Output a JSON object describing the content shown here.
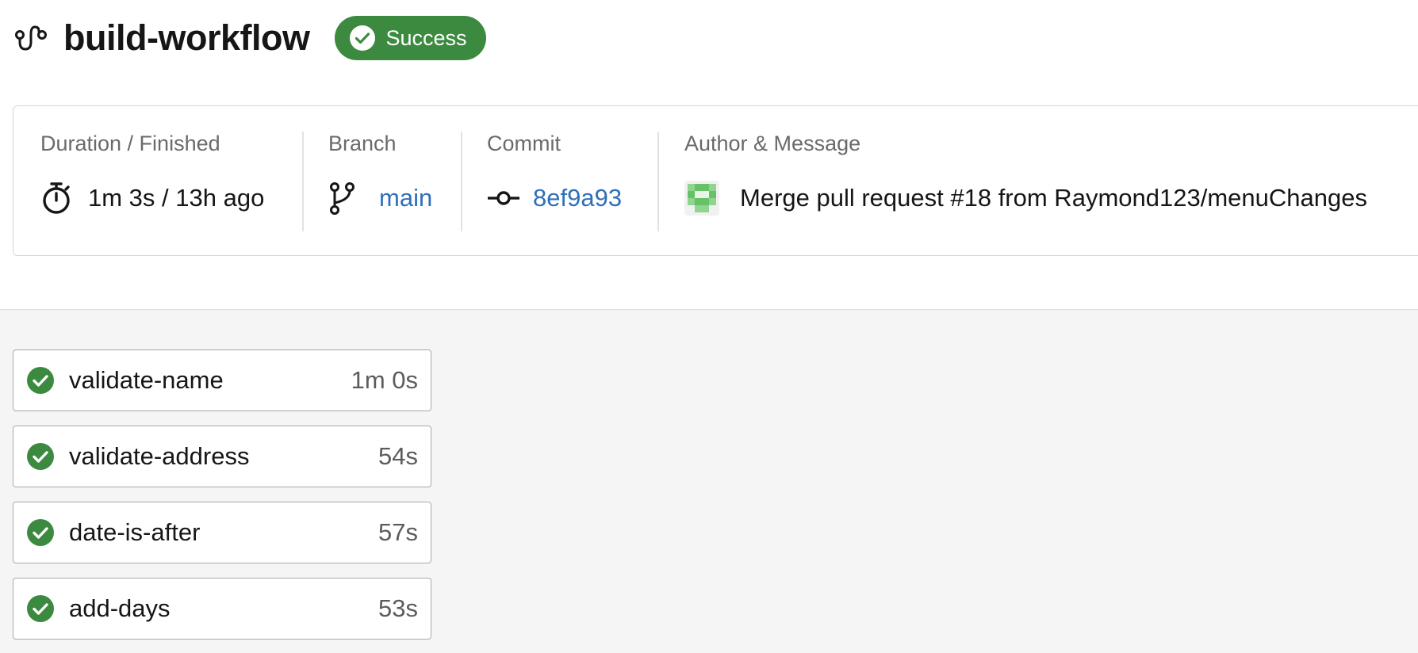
{
  "workflow": {
    "title": "build-workflow",
    "status": "Success",
    "icon": "workflow-icon",
    "status_color": "#3c8a3f"
  },
  "summary": {
    "duration": {
      "label": "Duration / Finished",
      "value": "1m 3s / 13h ago",
      "icon": "timer-icon"
    },
    "branch": {
      "label": "Branch",
      "value": "main",
      "icon": "branch-icon"
    },
    "commit": {
      "label": "Commit",
      "value": "8ef9a93",
      "icon": "commit-icon"
    },
    "author": {
      "label": "Author & Message",
      "message": "Merge pull request #18 from Raymond123/menuChanges",
      "icon": "avatar"
    }
  },
  "colors": {
    "success": "#3c8a3f",
    "link": "#2f6fba",
    "jobs_background": "#f5f5f5"
  },
  "jobs": [
    {
      "name": "validate-name",
      "duration": "1m 0s",
      "status": "success"
    },
    {
      "name": "validate-address",
      "duration": "54s",
      "status": "success"
    },
    {
      "name": "date-is-after",
      "duration": "57s",
      "status": "success"
    },
    {
      "name": "add-days",
      "duration": "53s",
      "status": "success"
    }
  ]
}
